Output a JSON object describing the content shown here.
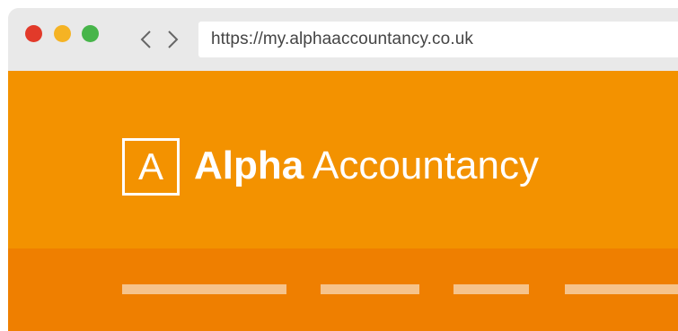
{
  "browser": {
    "window_controls": [
      {
        "name": "close",
        "color": "#e23a2a"
      },
      {
        "name": "minimize",
        "color": "#f5b324"
      },
      {
        "name": "maximize",
        "color": "#47b54a"
      }
    ],
    "back_icon": "chevron-left-icon",
    "forward_icon": "chevron-right-icon",
    "url": "https://my.alphaaccountancy.co.uk"
  },
  "site": {
    "logo_letter": "A",
    "brand_bold": "Alpha",
    "brand_light": " Accountancy",
    "colors": {
      "header": "#f39200",
      "nav": "#ef7f00",
      "nav_placeholder": "#f6c38b"
    }
  }
}
